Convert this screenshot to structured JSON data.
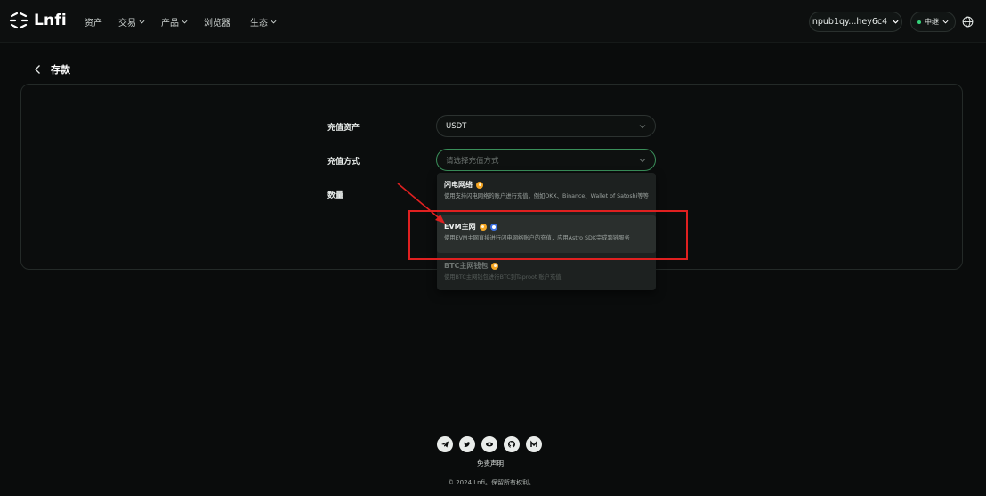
{
  "header": {
    "logo_text": "Lnfi",
    "nav": [
      {
        "label": "资产",
        "dropdown": false
      },
      {
        "label": "交易",
        "dropdown": true
      },
      {
        "label": "产品",
        "dropdown": true
      },
      {
        "label": "浏览器",
        "dropdown": false
      },
      {
        "label": "生态",
        "dropdown": true
      }
    ],
    "wallet_address": "npub1qy...hey6c4",
    "network_label": "中继"
  },
  "page": {
    "title": "存款"
  },
  "form": {
    "asset_label": "充值资产",
    "asset_value": "USDT",
    "method_label": "充值方式",
    "method_placeholder": "请选择充值方式",
    "amount_label": "数量"
  },
  "dropdown": {
    "items": [
      {
        "title": "闪电网络",
        "desc": "使用支持闪电网络的账户进行充值，例如OKX、Binance、Wallet of Satoshi等等",
        "icons": [
          "btc-coin-icon"
        ]
      },
      {
        "title": "EVM主网",
        "desc": "使用EVM主网直接进行闪电网络账户的充值，应用Astro SDK完成跨链服务",
        "icons": [
          "btc-coin-icon",
          "eth-coin-icon"
        ]
      },
      {
        "title": "BTC主网钱包",
        "desc": "使用BTC主网钱包进行BTC到Taproot 账户充值",
        "icons": [
          "btc-coin-icon"
        ]
      }
    ]
  },
  "footer": {
    "social_icons": [
      "telegram-icon",
      "twitter-icon",
      "medium-icon",
      "github-icon",
      "mirror-icon"
    ],
    "disclaimer": "免责声明",
    "copyright": "© 2024 Lnfi。保留所有权利。"
  },
  "colors": {
    "background": "#0a0c0c",
    "accent_green": "#35d27a",
    "annotation_red": "#e02020",
    "btc_orange": "#f5a623",
    "eth_blue": "#3b6fe0"
  }
}
